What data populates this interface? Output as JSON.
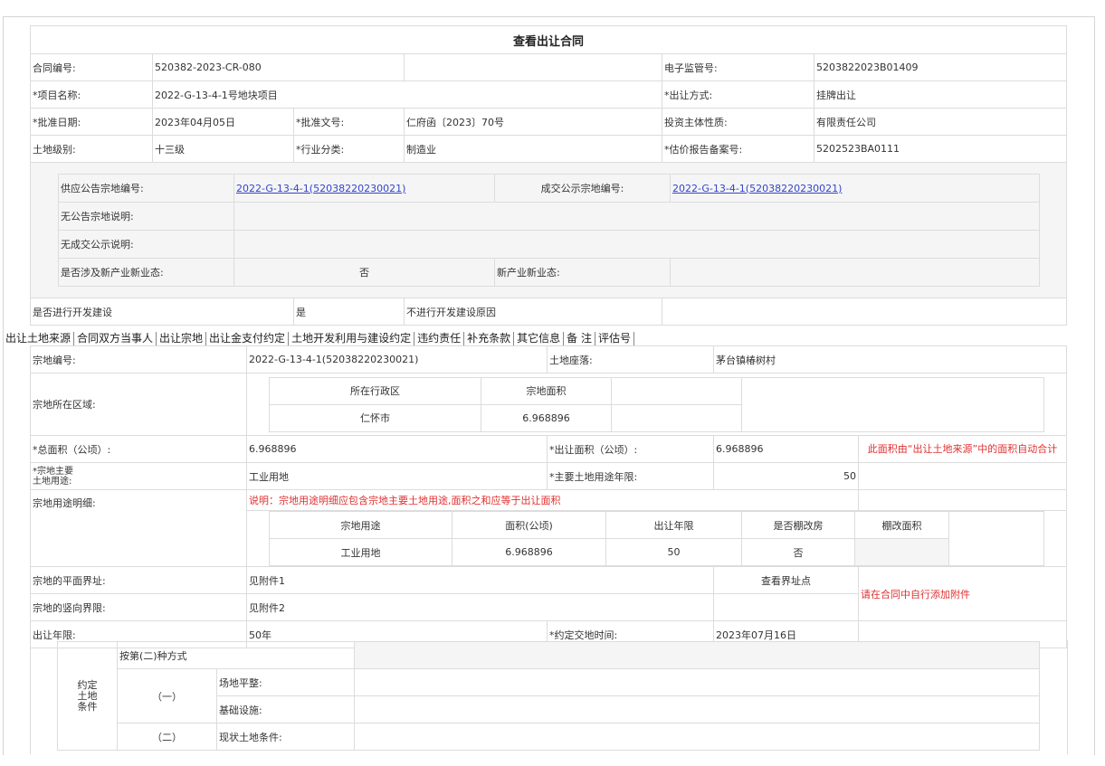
{
  "header": {
    "title": "查看出让合同"
  },
  "contract": {
    "no_label": "合同编号:",
    "no_value": "520382-2023-CR-080",
    "supervise_label": "电子监管号:",
    "supervise_value": "5203822023B01409",
    "project_label": "*项目名称:",
    "project_value": "2022-G-13-4-1号地块项目",
    "method_label": "*出让方式:",
    "method_value": "挂牌出让",
    "approve_date_label": "*批准日期:",
    "approve_date_value": "2023年04月05日",
    "approve_doc_label": "*批准文号:",
    "approve_doc_value": "仁府函〔2023〕70号",
    "investor_label": "投资主体性质:",
    "investor_value": "有限责任公司",
    "level_label": "土地级别:",
    "level_value": "十三级",
    "industry_label": "*行业分类:",
    "industry_value": "制造业",
    "estimate_label": "*估价报告备案号:",
    "estimate_value": "5202523BA0111"
  },
  "inner": {
    "supply_label": "供应公告宗地编号:",
    "supply_value": "2022-G-13-4-1(52038220230021)",
    "deal_label": "成交公示宗地编号:",
    "deal_value": "2022-G-13-4-1(52038220230021)",
    "no_notice_label": "无公告宗地说明:",
    "no_deal_label": "无成交公示说明:",
    "new_industry_label": "是否涉及新产业新业态:",
    "new_industry_value": "否",
    "new_format_label": "新产业新业态:"
  },
  "develop": {
    "label": "是否进行开发建设",
    "value": "是",
    "reason_label": "不进行开发建设原因"
  },
  "tabs": [
    "出让土地来源",
    "合同双方当事人",
    "出让宗地",
    "出让金支付约定",
    "土地开发利用与建设约定",
    "违约责任",
    "补充条款",
    "其它信息",
    "备 注",
    "评估号"
  ],
  "parcel": {
    "no_label": "宗地编号:",
    "no_value": "2022-G-13-4-1(52038220230021)",
    "location_label": "土地座落:",
    "location_value": "茅台镇椿树村",
    "region_label": "宗地所在区域:",
    "region_head1": "所在行政区",
    "region_head2": "宗地面积",
    "region_val1": "仁怀市",
    "region_val2": "6.968896",
    "total_area_label": "*总面积（公顷）:",
    "total_area_value": "6.968896",
    "sell_area_label": "*出让面积（公顷）:",
    "sell_area_value": "6.968896",
    "area_note": "此面积由“出让土地来源”中的面积自动合计",
    "main_use_label": "*宗地主要\n土地用途:",
    "main_use_value": "工业用地",
    "main_years_label": "*主要土地用途年限:",
    "main_years_value": "50",
    "use_note": "说明：宗地用途明细应包含宗地主要土地用途,面积之和应等于出让面积",
    "use_detail_label": "宗地用途明细:",
    "use_heads": [
      "宗地用途",
      "面积(公顷)",
      "出让年限",
      "是否棚改房",
      "棚改面积"
    ],
    "use_row": [
      "工业用地",
      "6.968896",
      "50",
      "否",
      ""
    ],
    "plane_label": "宗地的平面界址:",
    "plane_value": "见附件1",
    "view_points": "查看界址点",
    "attach_note": "请在合同中自行添加附件",
    "vertical_label": "宗地的竖向界限:",
    "vertical_value": "见附件2",
    "term_label": "出让年限:",
    "term_value": "50年",
    "deliver_label": "*约定交地时间:",
    "deliver_value": "2023年07月16日"
  },
  "condition": {
    "side_label": "约定\n土地\n条件",
    "method": "按第(二)种方式",
    "one": "（一）",
    "two": "（二）",
    "site_label": "场地平整:",
    "infra_label": "基础设施:",
    "status_label": "现状土地条件:"
  }
}
